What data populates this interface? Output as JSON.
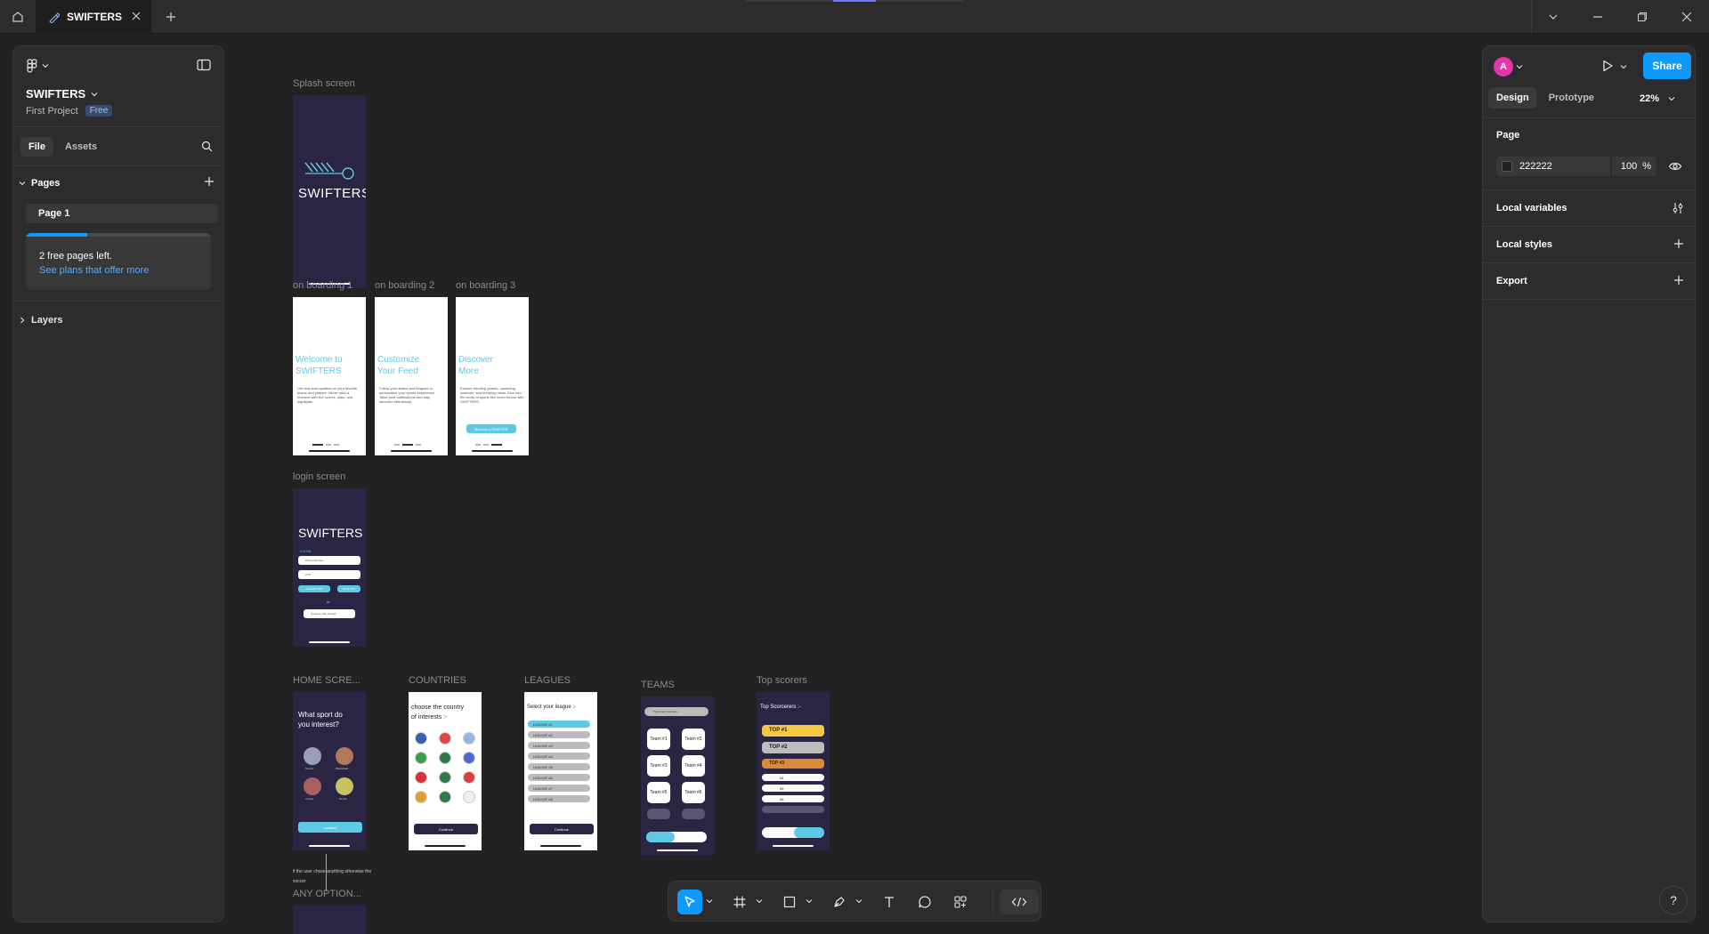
{
  "titlebar": {
    "tab_title": "SWIFTERS"
  },
  "left_panel": {
    "file_name": "SWIFTERS",
    "project": "First Project",
    "plan_badge": "Free",
    "tabs": [
      "File",
      "Assets"
    ],
    "pages_header": "Pages",
    "pages": [
      "Page 1"
    ],
    "upsell_text": "2 free pages left.",
    "upsell_link": "See plans that offer more",
    "upsell_progress": 0.33,
    "layers_header": "Layers"
  },
  "right_panel": {
    "avatar_initial": "A",
    "share_label": "Share",
    "tabs": [
      "Design",
      "Prototype"
    ],
    "zoom": "22%",
    "page_section": "Page",
    "page_color": "222222",
    "page_opacity": "100",
    "percent_sign": "%",
    "local_variables": "Local variables",
    "local_styles": "Local styles",
    "export": "Export"
  },
  "canvas": {
    "frames": {
      "splash": {
        "label": "Splash screen",
        "logo": "SWIFTERS"
      },
      "onboarding1": {
        "label": "on boarding 1",
        "title1": "Welcome to",
        "title2": "SWIFTERS",
        "body": "Get real-time updates on your favorite teams and players. Never miss a moment with live scores, stats, and highlights."
      },
      "onboarding2": {
        "label": "on boarding 2",
        "title1": "Customize",
        "title2": "Your Feed",
        "body": "Follow your teams and leagues to personalize your sports experience. Tailor your notifications and stay informed effortlessly."
      },
      "onboarding3": {
        "label": "on boarding 3",
        "title1": "Discover",
        "title2": "More",
        "body": "Explore trending games, upcoming matches, and breaking news. Dive into the world of sports like never before with SWIFTERS.",
        "cta": "Become a SWIFTER"
      },
      "login": {
        "label": "login screen",
        "logo": "SWIFTERS",
        "heading": "LOGIN",
        "input1": "Phone Number",
        "input2": "OTP",
        "btn1": "Send the OTP",
        "btn2": "Verify OTP",
        "or": "or",
        "google": "Continue with Google"
      },
      "home": {
        "label": "HOME SCRE...",
        "title1": "What sport do",
        "title2": "you interest?",
        "sports": [
          "Soccer",
          "Basketball",
          "Cricket",
          "Tennis"
        ],
        "cta": "continue"
      },
      "countries": {
        "label": "COUNTRIES",
        "title1": "choose the country",
        "title2": "of interests :-",
        "cta": "Continue"
      },
      "leagues": {
        "label": "LEAGUES",
        "title": "Select your league :-",
        "items": [
          "LEAGUE #1",
          "LEAGUE #2",
          "LEAGUE #3",
          "LEAGUE #4",
          "LEAGUE #5",
          "LEAGUE #6",
          "LEAGUE #7",
          "LEAGUE #8"
        ],
        "cta": "Continue"
      },
      "teams": {
        "label": "TEAMS",
        "search": "Type team you want",
        "items": [
          "Team #1",
          "Team #2",
          "Team #3",
          "Team #4",
          "Team #5",
          "Team #6"
        ]
      },
      "top_scorers": {
        "label": "Top scorers",
        "title": "Top Scorcerers :-",
        "items": [
          "TOP #1",
          "TOP #2",
          "TOP #3",
          "#4",
          "#5",
          "#6"
        ]
      },
      "any_option": {
        "label": "ANY OPTION...",
        "note": "if the user chose anything otherwise the soccer"
      }
    }
  },
  "colors": {
    "accent": "#0d99ff",
    "canvas": "#222222",
    "frame_dark": "#2a2542",
    "cyan": "#5ec9e4",
    "gold": "#f5c842",
    "silver": "#bdbdbd",
    "bronze": "#d98a3a",
    "avatar": "#e535ab"
  }
}
